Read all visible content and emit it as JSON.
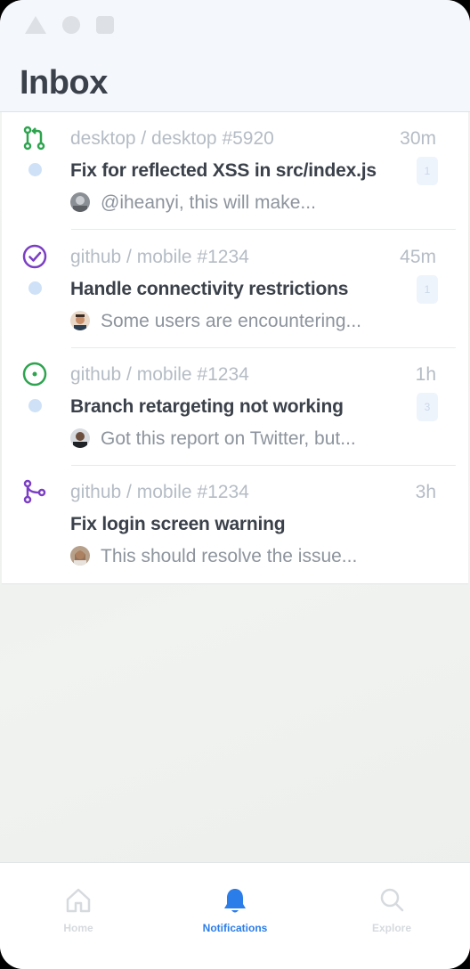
{
  "page": {
    "title": "Inbox"
  },
  "colors": {
    "accent": "#2b7de9",
    "pr_green": "#2ea44f",
    "purple": "#7b3fc4",
    "unread": "#cfe1f7"
  },
  "notifications": [
    {
      "icon": "pull-request-icon",
      "repo": "desktop / desktop #5920",
      "time": "30m",
      "title": "Fix for reflected XSS in src/index.js",
      "count": "1",
      "snippet": "@iheanyi, this will make...",
      "unread": true
    },
    {
      "icon": "check-circle-icon",
      "repo": "github / mobile #1234",
      "time": "45m",
      "title": "Handle connectivity restrictions",
      "count": "1",
      "snippet": "Some users are encountering...",
      "unread": true
    },
    {
      "icon": "issue-open-icon",
      "repo": "github / mobile #1234",
      "time": "1h",
      "title": "Branch retargeting not working",
      "count": "3",
      "snippet": "Got this report on Twitter, but...",
      "unread": true
    },
    {
      "icon": "merged-icon",
      "repo": "github / mobile #1234",
      "time": "3h",
      "title": "Fix login screen warning",
      "snippet": "This should resolve the issue...",
      "unread": false
    }
  ],
  "tabs": [
    {
      "label": "Home",
      "icon": "home-icon"
    },
    {
      "label": "Notifications",
      "icon": "bell-icon",
      "active": true
    },
    {
      "label": "Explore",
      "icon": "search-icon"
    }
  ]
}
